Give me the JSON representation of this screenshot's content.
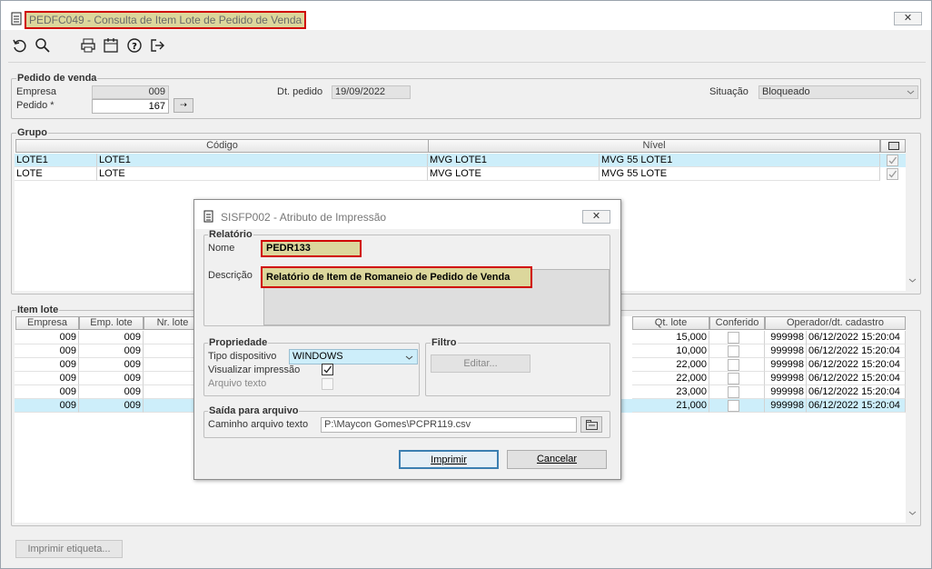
{
  "window": {
    "title": "PEDFC049 - Consulta de Item Lote de Pedido de Venda",
    "close": "✕"
  },
  "toolbar": [
    {
      "name": "refresh-icon",
      "glyph": "↺"
    },
    {
      "name": "search-icon",
      "glyph": "⌕"
    },
    {
      "name": "print-icon",
      "glyph": "⎙"
    },
    {
      "name": "calendar-icon",
      "glyph": "▦"
    },
    {
      "name": "help-icon",
      "glyph": "?"
    },
    {
      "name": "exit-icon",
      "glyph": "⇥"
    }
  ],
  "pedido": {
    "legend": "Pedido de venda",
    "empresa_label": "Empresa",
    "empresa": "009",
    "pedido_label": "Pedido *",
    "pedido": "167",
    "dt_label": "Dt. pedido",
    "dt": "19/09/2022",
    "sit_label": "Situação",
    "sit": "Bloqueado"
  },
  "grupo": {
    "legend": "Grupo",
    "headers": [
      "Código",
      "Nível"
    ],
    "rows": [
      {
        "c1": "LOTE1",
        "c2": "LOTE1",
        "c3": "MVG LOTE1",
        "c4": "MVG 55 LOTE1",
        "checked": true,
        "selected": true
      },
      {
        "c1": "LOTE",
        "c2": "LOTE",
        "c3": "MVG LOTE",
        "c4": "MVG 55 LOTE",
        "checked": true,
        "selected": false
      }
    ]
  },
  "itemlote": {
    "legend": "Item lote",
    "headers": [
      "Empresa",
      "Emp. lote",
      "Nr. lote",
      "Qt. lote",
      "Conferido",
      "Operador/dt. cadastro"
    ],
    "rows": [
      {
        "emp": "009",
        "emplote": "009",
        "qt": "15,000",
        "op": "999998",
        "dt": "06/12/2022 15:20:04",
        "selected": false
      },
      {
        "emp": "009",
        "emplote": "009",
        "qt": "10,000",
        "op": "999998",
        "dt": "06/12/2022 15:20:04",
        "selected": false
      },
      {
        "emp": "009",
        "emplote": "009",
        "qt": "22,000",
        "op": "999998",
        "dt": "06/12/2022 15:20:04",
        "selected": false
      },
      {
        "emp": "009",
        "emplote": "009",
        "qt": "22,000",
        "op": "999998",
        "dt": "06/12/2022 15:20:04",
        "selected": false
      },
      {
        "emp": "009",
        "emplote": "009",
        "qt": "23,000",
        "op": "999998",
        "dt": "06/12/2022 15:20:04",
        "selected": false
      },
      {
        "emp": "009",
        "emplote": "009",
        "qt": "21,000",
        "op": "999998",
        "dt": "06/12/2022 15:20:04",
        "selected": true
      }
    ]
  },
  "footer": {
    "imprimir_etiqueta": "Imprimir etiqueta..."
  },
  "dialog": {
    "title": "SISFP002 - Atributo de Impressão",
    "close": "✕",
    "relatorio_legend": "Relatório",
    "nome_label": "Nome",
    "nome": "PEDR133",
    "descricao_label": "Descrição",
    "descricao": "Relatório de Item de Romaneio de Pedido de Venda",
    "propriedade_legend": "Propriedade",
    "tipo_label": "Tipo dispositivo",
    "tipo": "WINDOWS",
    "visualizar_label": "Visualizar impressão",
    "arquivo_label": "Arquivo texto",
    "filtro_legend": "Filtro",
    "editar": "Editar...",
    "saida_legend": "Saída para arquivo",
    "caminho_label": "Caminho arquivo texto",
    "caminho": "P:\\Maycon Gomes\\PCPR119.csv",
    "imprimir": "Imprimir",
    "cancelar": "Cancelar"
  },
  "colors": {
    "highlight": "#d00000",
    "title_fill": "#dcd79c",
    "selected_row": "#cdeefa"
  }
}
